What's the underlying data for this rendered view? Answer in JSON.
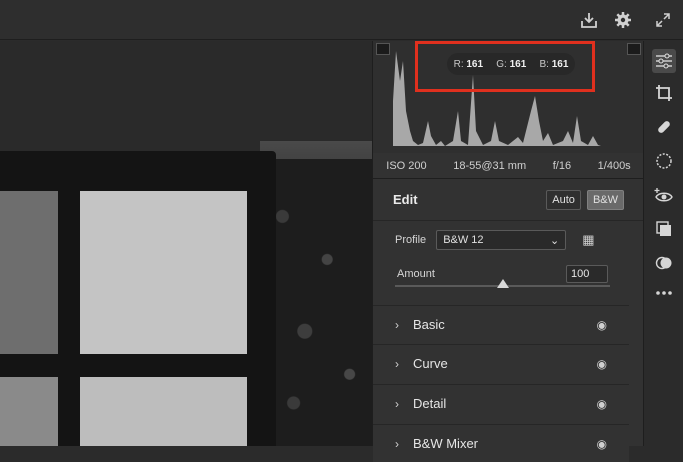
{
  "topbar": {
    "icons": [
      "download-icon",
      "gear-icon",
      "expand-icon"
    ]
  },
  "histogram": {
    "r_label": "R:",
    "r_value": "161",
    "g_label": "G:",
    "g_value": "161",
    "b_label": "B:",
    "b_value": "161"
  },
  "exif": {
    "iso": "ISO 200",
    "lens": "18-55@31 mm",
    "aperture": "f/16",
    "shutter": "1/400s"
  },
  "edit": {
    "title": "Edit",
    "auto_label": "Auto",
    "bw_label": "B&W"
  },
  "profile": {
    "label": "Profile",
    "value": "B&W 12"
  },
  "amount": {
    "label": "Amount",
    "value": "100",
    "level_fraction": 0.5
  },
  "sections": [
    {
      "label": "Basic"
    },
    {
      "label": "Curve"
    },
    {
      "label": "Detail"
    },
    {
      "label": "B&W Mixer"
    }
  ],
  "toolbar": {
    "tools": [
      "sliders-icon",
      "crop-icon",
      "healing-icon",
      "mask-icon",
      "redeye-icon",
      "presets-icon",
      "snapshots-icon",
      "more-icon"
    ]
  },
  "colors": {
    "highlight_box": "#e0301e",
    "panel_bg": "#323232"
  }
}
